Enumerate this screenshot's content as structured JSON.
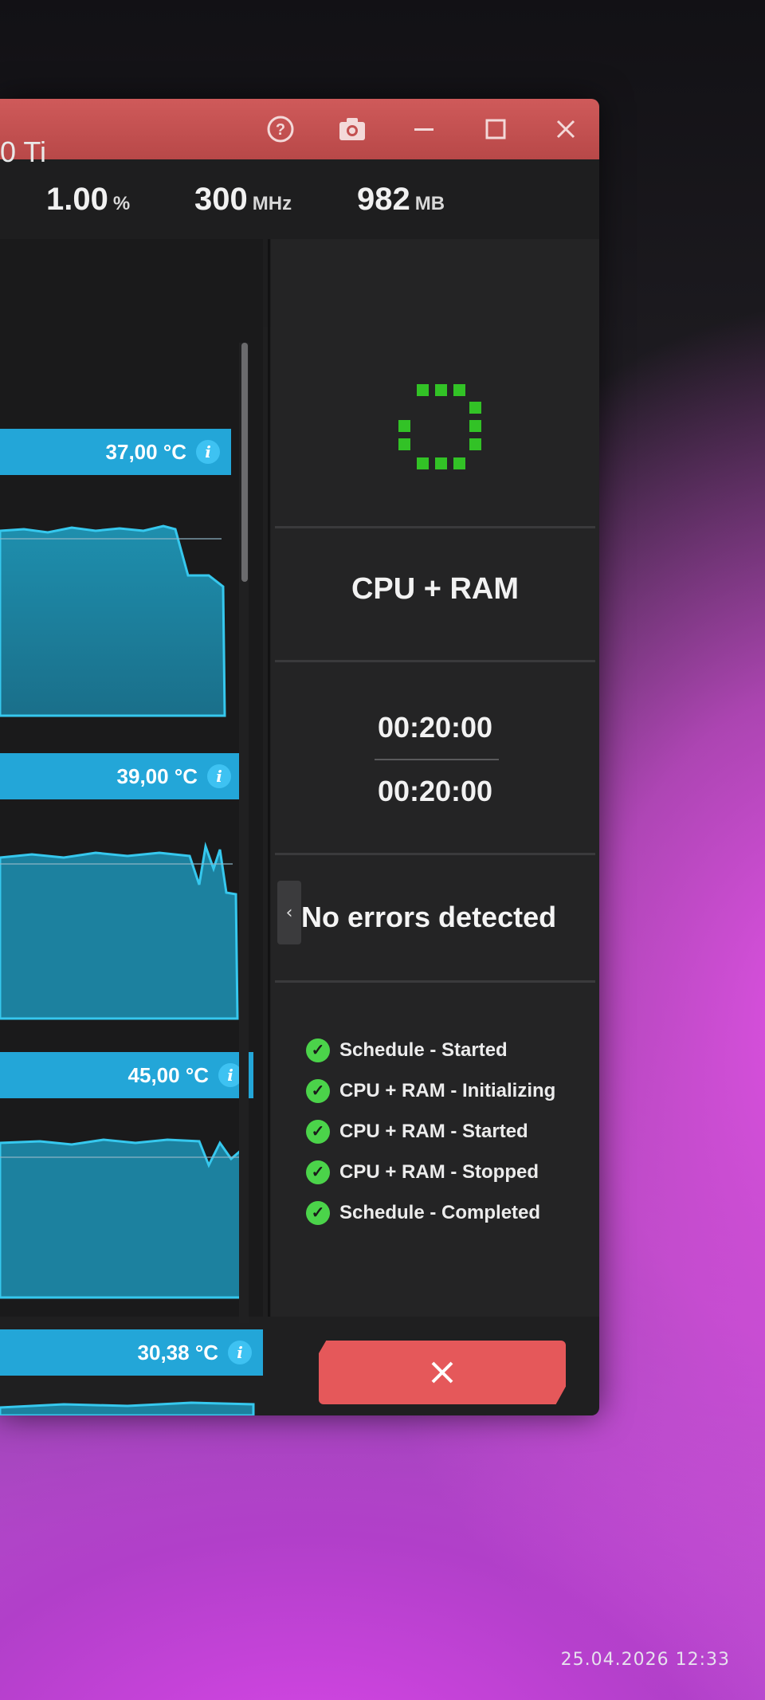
{
  "window": {
    "title_icons": [
      "help-icon",
      "camera-icon",
      "minimize-icon",
      "maximize-icon",
      "close-icon"
    ],
    "title_bar_color": "#c45050",
    "accent_color": "#23a6d8"
  },
  "header": {
    "gpu_name_fragment": "0 Ti",
    "stats": [
      {
        "value": "1.00",
        "unit": "%"
      },
      {
        "value": "300",
        "unit": "MHz"
      },
      {
        "value": "982",
        "unit": "MB"
      }
    ]
  },
  "sensors": [
    {
      "reading": "37,00 °C"
    },
    {
      "reading": "39,00 °C"
    },
    {
      "reading": "45,00 °C"
    },
    {
      "reading": "30,38 °C"
    }
  ],
  "test": {
    "mode": "CPU + RAM",
    "elapsed": "00:20:00",
    "duration": "00:20:00",
    "status": "No errors detected",
    "log": [
      "Schedule - Started",
      "CPU + RAM - Initializing",
      "CPU + RAM - Started",
      "CPU + RAM - Stopped",
      "Schedule - Completed"
    ],
    "stop_button_icon": "close-icon"
  },
  "footer": {
    "camera_timestamp": "25.04.2026  12:33"
  }
}
